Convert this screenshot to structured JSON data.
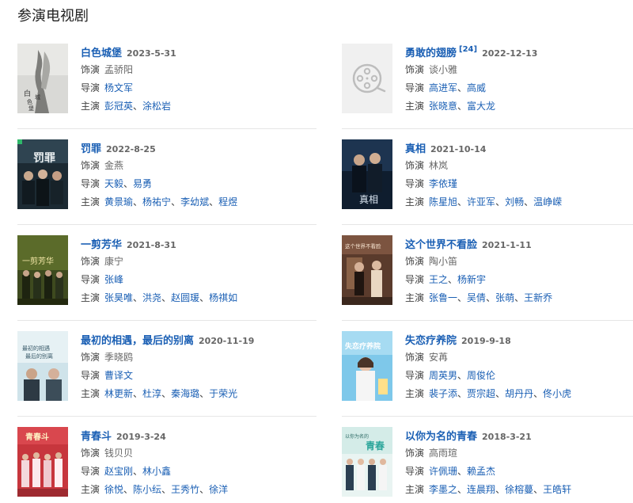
{
  "section": {
    "title": "参演电视剧"
  },
  "labels": {
    "role": "饰演",
    "director": "导演",
    "star": "主演",
    "separator": "、"
  },
  "works": [
    {
      "title": "白色城堡",
      "date": "2023-5-31",
      "role": "孟骄阳",
      "directors": [
        "杨文军"
      ],
      "stars": [
        "彭冠英",
        "涂松岩"
      ],
      "poster": "white-castle-poster"
    },
    {
      "title": "勇敢的翅膀",
      "ref": "[24]",
      "date": "2022-12-13",
      "role": "谈小雅",
      "directors": [
        "高进军",
        "高威"
      ],
      "stars": [
        "张晓意",
        "富大龙"
      ],
      "poster": "film-reel-placeholder-icon"
    },
    {
      "title": "罚罪",
      "date": "2022-8-25",
      "role": "金燕",
      "directors": [
        "天毅",
        "易勇"
      ],
      "stars": [
        "黄景瑜",
        "杨祐宁",
        "李幼斌",
        "程煜"
      ],
      "poster": "punishment-poster"
    },
    {
      "title": "真相",
      "date": "2021-10-14",
      "role": "林岚",
      "directors": [
        "李依瑾"
      ],
      "stars": [
        "陈星旭",
        "许亚军",
        "刘畅",
        "温峥嵘"
      ],
      "poster": "truth-poster"
    },
    {
      "title": "一剪芳华",
      "date": "2021-8-31",
      "role": "康宁",
      "directors": [
        "张峰"
      ],
      "stars": [
        "张昊唯",
        "洪尧",
        "赵圆瑗",
        "杨祺如"
      ],
      "poster": "yi-jian-fang-hua-poster"
    },
    {
      "title": "这个世界不看脸",
      "date": "2021-1-11",
      "role": "陶小笛",
      "directors": [
        "王之",
        "杨新宇"
      ],
      "stars": [
        "张鲁一",
        "吴倩",
        "张萌",
        "王新乔"
      ],
      "poster": "world-not-face-poster"
    },
    {
      "title": "最初的相遇，最后的别离",
      "date": "2020-11-19",
      "role": "季晓鸥",
      "directors": [
        "曹译文"
      ],
      "stars": [
        "林更新",
        "杜淳",
        "秦海璐",
        "于荣光"
      ],
      "poster": "first-meeting-poster"
    },
    {
      "title": "失恋疗养院",
      "date": "2019-9-18",
      "role": "安苒",
      "directors": [
        "周英男",
        "周俊伦"
      ],
      "stars": [
        "裴子添",
        "贾宗超",
        "胡丹丹",
        "佟小虎"
      ],
      "poster": "lovelorn-sanatorium-poster"
    },
    {
      "title": "青春斗",
      "date": "2019-3-24",
      "role": "钱贝贝",
      "directors": [
        "赵宝刚",
        "林小鑫"
      ],
      "stars": [
        "徐悦",
        "陈小纭",
        "王秀竹",
        "徐洋"
      ],
      "poster": "youth-fight-poster"
    },
    {
      "title": "以你为名的青春",
      "date": "2018-3-21",
      "role": "高雨瑄",
      "directors": [
        "许佩珊",
        "赖孟杰"
      ],
      "stars": [
        "李墨之",
        "连晨翔",
        "徐榕蔓",
        "王皓轩"
      ],
      "poster": "youth-in-your-name-poster"
    }
  ]
}
